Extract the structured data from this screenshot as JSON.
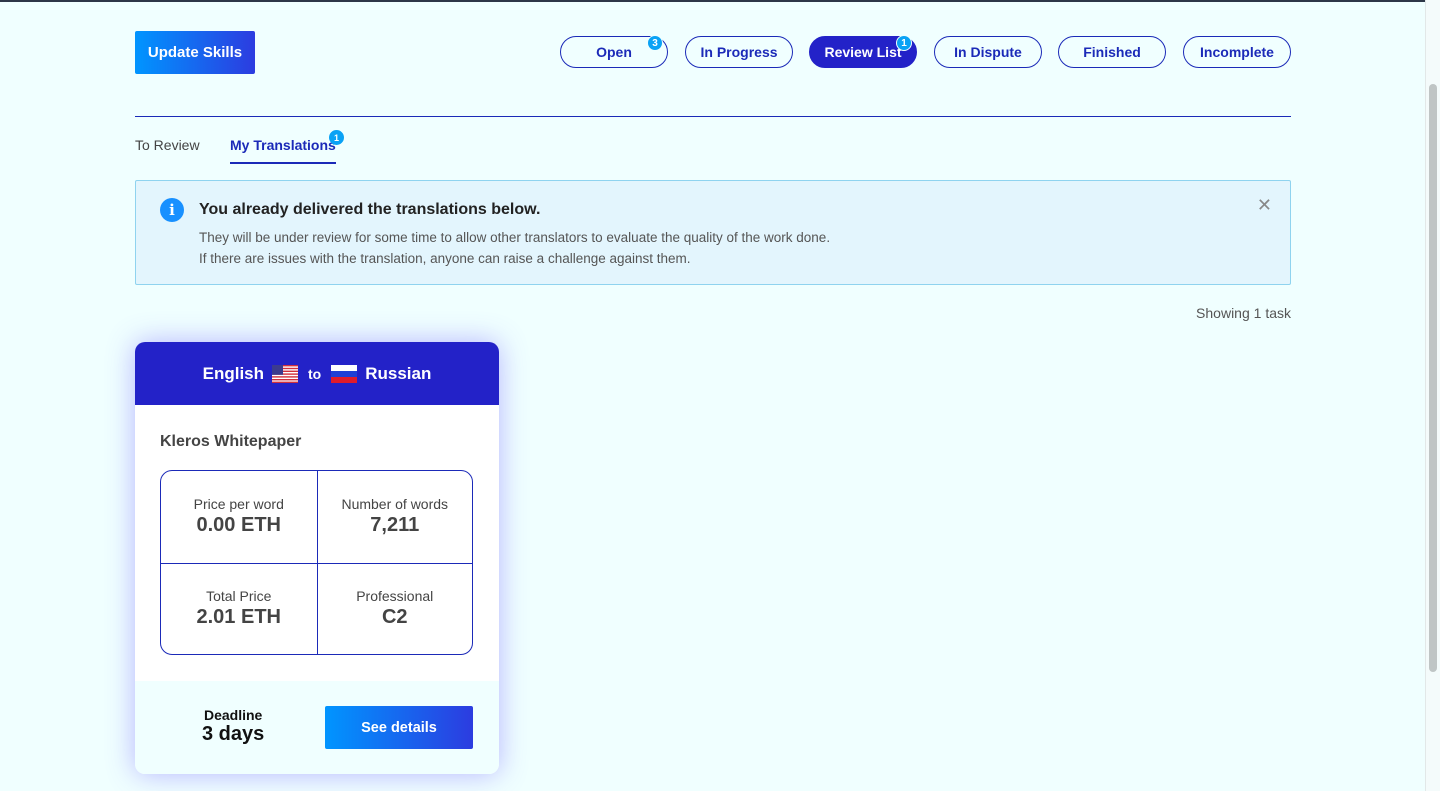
{
  "header": {
    "update_skills_label": "Update Skills"
  },
  "status_tabs": [
    {
      "label": "Open",
      "badge": "3"
    },
    {
      "label": "In Progress",
      "badge": ""
    },
    {
      "label": "Review List",
      "badge": "1",
      "active": true
    },
    {
      "label": "In Dispute",
      "badge": ""
    },
    {
      "label": "Finished",
      "badge": ""
    },
    {
      "label": "Incomplete",
      "badge": ""
    }
  ],
  "subtabs": {
    "to_review": "To Review",
    "my_translations": "My Translations",
    "my_translations_badge": "1"
  },
  "alert": {
    "title": "You already delivered the translations below.",
    "line1": "They will be under review for some time to allow other translators to evaluate the quality of the work done.",
    "line2": "If there are issues with the translation, anyone can raise a challenge against them.",
    "close_symbol": "✕"
  },
  "showing_text": "Showing 1 task",
  "task_card": {
    "source_language": "English",
    "to_word": "to",
    "target_language": "Russian",
    "title": "Kleros Whitepaper",
    "price_per_word_label": "Price per word",
    "price_per_word_value": "0.00 ETH",
    "number_of_words_label": "Number of words",
    "number_of_words_value": "7,211",
    "total_price_label": "Total Price",
    "total_price_value": "2.01 ETH",
    "level_label": "Professional",
    "level_value": "C2",
    "deadline_label": "Deadline",
    "deadline_value": "3 days",
    "details_label": "See details"
  },
  "icons": {
    "info": "info-icon",
    "close": "close-icon",
    "source_flag": "us-flag-icon",
    "target_flag": "russia-flag-icon"
  },
  "colors": {
    "background": "#f0ffff",
    "primary": "#2322c8",
    "accent_blue": "#0095ff",
    "badge": "#0aa2f5"
  }
}
